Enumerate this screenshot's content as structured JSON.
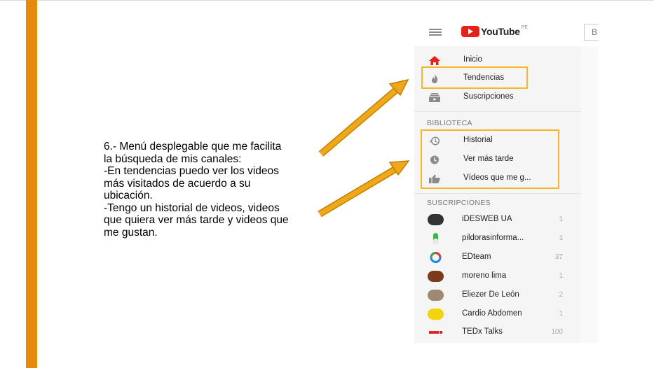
{
  "slide": {
    "lines": [
      "6.- Menú desplegable que me facilita",
      "la búsqueda de mis canales:",
      "-En tendencias puedo ver los videos",
      "más visitados de acuerdo a su",
      "ubicación.",
      "-Tengo un historial de videos, videos",
      "que quiera ver más tarde y videos que",
      "me gustan."
    ]
  },
  "youtube": {
    "logo_text": "YouTube",
    "region": "PE",
    "search_partial": "B",
    "main_menu": [
      {
        "label": "Inicio",
        "icon": "home-icon",
        "color": "#e62117"
      },
      {
        "label": "Tendencias",
        "icon": "flame-icon",
        "color": "#8a8a8a"
      },
      {
        "label": "Suscripciones",
        "icon": "subscriptions-icon",
        "color": "#8a8a8a"
      }
    ],
    "library_title": "BIBLIOTECA",
    "library_menu": [
      {
        "label": "Historial",
        "icon": "history-icon"
      },
      {
        "label": "Ver más tarde",
        "icon": "clock-icon"
      },
      {
        "label": "Vídeos que me g...",
        "icon": "thumbs-up-icon"
      }
    ],
    "subscriptions_title": "SUSCRIPCIONES",
    "subscriptions": [
      {
        "name": "iDESWEB UA",
        "count": "1",
        "avatar_color": "#333333"
      },
      {
        "name": "pildorasinforma...",
        "count": "1",
        "avatar_color": "#3cb44b"
      },
      {
        "name": "EDteam",
        "count": "37",
        "avatar_color": "#1e88e5"
      },
      {
        "name": "moreno lima",
        "count": "1",
        "avatar_color": "#7a3b1e"
      },
      {
        "name": "Eliezer De León",
        "count": "2",
        "avatar_color": "#9e8a72"
      },
      {
        "name": "Cardio Abdomen",
        "count": "1",
        "avatar_color": "#f2d40a"
      },
      {
        "name": "TEDx Talks",
        "count": "100",
        "avatar_color": "#e62117"
      }
    ]
  },
  "colors": {
    "accent_bar": "#e8890c",
    "highlight": "#f7b52c",
    "arrow": "#f0a81a"
  }
}
